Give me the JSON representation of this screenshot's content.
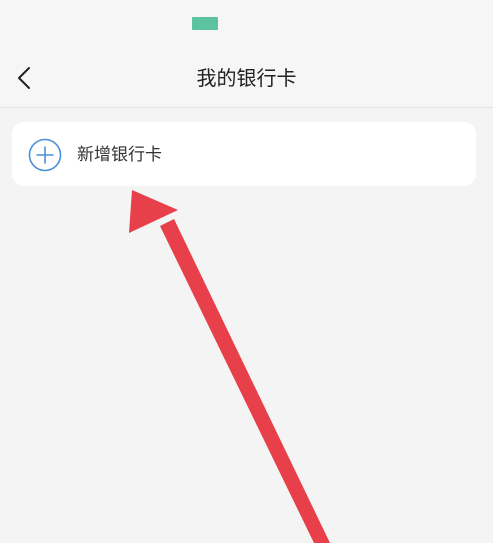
{
  "status_bar": {
    "indicator_color": "#5cc3a0"
  },
  "nav": {
    "back_icon": "chevron-left-icon",
    "title": "我的银行卡"
  },
  "add_card": {
    "icon": "plus-circle-icon",
    "icon_color": "#4a90d9",
    "label": "新增银行卡"
  },
  "annotation": {
    "type": "arrow",
    "color": "#e8404a",
    "points_to": "add-card-button"
  }
}
